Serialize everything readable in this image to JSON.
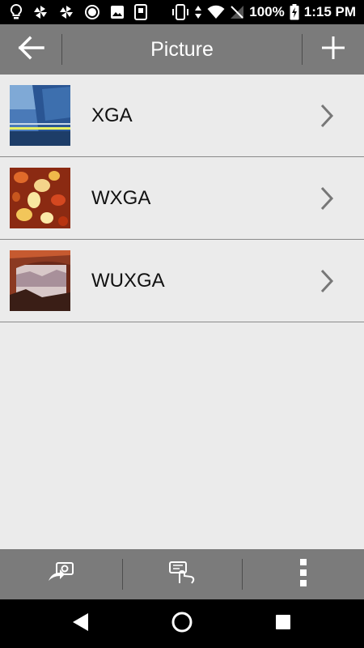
{
  "status_bar": {
    "battery_percent": "100%",
    "time": "1:15 PM"
  },
  "toolbar": {
    "title": "Picture",
    "back_icon": "arrow-left-icon",
    "add_icon": "plus-icon"
  },
  "pictures": [
    {
      "label": "XGA",
      "icon": "chevron-right-icon"
    },
    {
      "label": "WXGA",
      "icon": "chevron-right-icon"
    },
    {
      "label": "WUXGA",
      "icon": "chevron-right-icon"
    }
  ],
  "bottom_bar": {
    "icons": [
      "project-image-icon",
      "touch-transfer-icon",
      "more-vert-icon"
    ]
  },
  "colors": {
    "toolbar": "#7b7b7b",
    "background": "#ebebeb",
    "divider": "#8a8a8a"
  }
}
